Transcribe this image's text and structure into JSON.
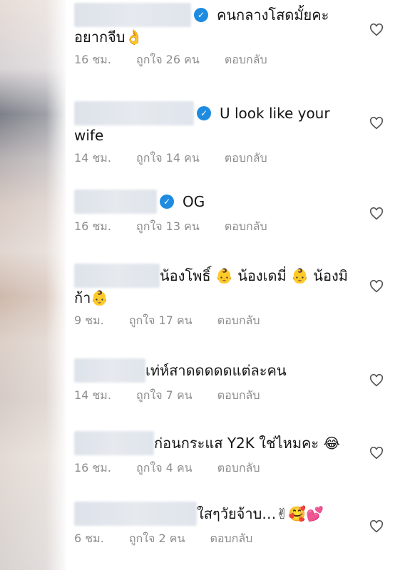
{
  "comments": [
    {
      "text": "คนกลางโสดมั้ยคะ",
      "text_cont": "อยากจีบ👌",
      "time": "16 ชม.",
      "likes": "ถูกใจ 26 คน",
      "reply": "ตอบกลับ"
    },
    {
      "text": "U look like your",
      "text_cont": "wife",
      "time": "14 ชม.",
      "likes": "ถูกใจ 14 คน",
      "reply": "ตอบกลับ"
    },
    {
      "text": "OG",
      "time": "16 ชม.",
      "likes": "ถูกใจ 13 คน",
      "reply": "ตอบกลับ"
    },
    {
      "text": "น้องโพธิ์ 👶 น้องเดมี่ 👶 น้องมิ",
      "text_cont": "ก้า👶",
      "time": "9 ชม.",
      "likes": "ถูกใจ 17 คน",
      "reply": "ตอบกลับ"
    },
    {
      "text": "เท่ห์สาดดดดดแต่ละคน",
      "time": "14 ชม.",
      "likes": "ถูกใจ 7 คน",
      "reply": "ตอบกลับ"
    },
    {
      "text": "ก่อนกระแส Y2K ใช่ไหมคะ 😂",
      "time": "16 ชม.",
      "likes": "ถูกใจ 4 คน",
      "reply": "ตอบกลับ"
    },
    {
      "text": "ใสๆวัยจ้าบ…✌🥰💕",
      "time": "6 ชม.",
      "likes": "ถูกใจ 2 คน",
      "reply": "ตอบกลับ"
    }
  ],
  "icons": {
    "like": "heart-outline-icon",
    "verified": "verified-badge-icon"
  },
  "colors": {
    "verified": "#1d8ce0",
    "meta": "#8d8d8d"
  }
}
